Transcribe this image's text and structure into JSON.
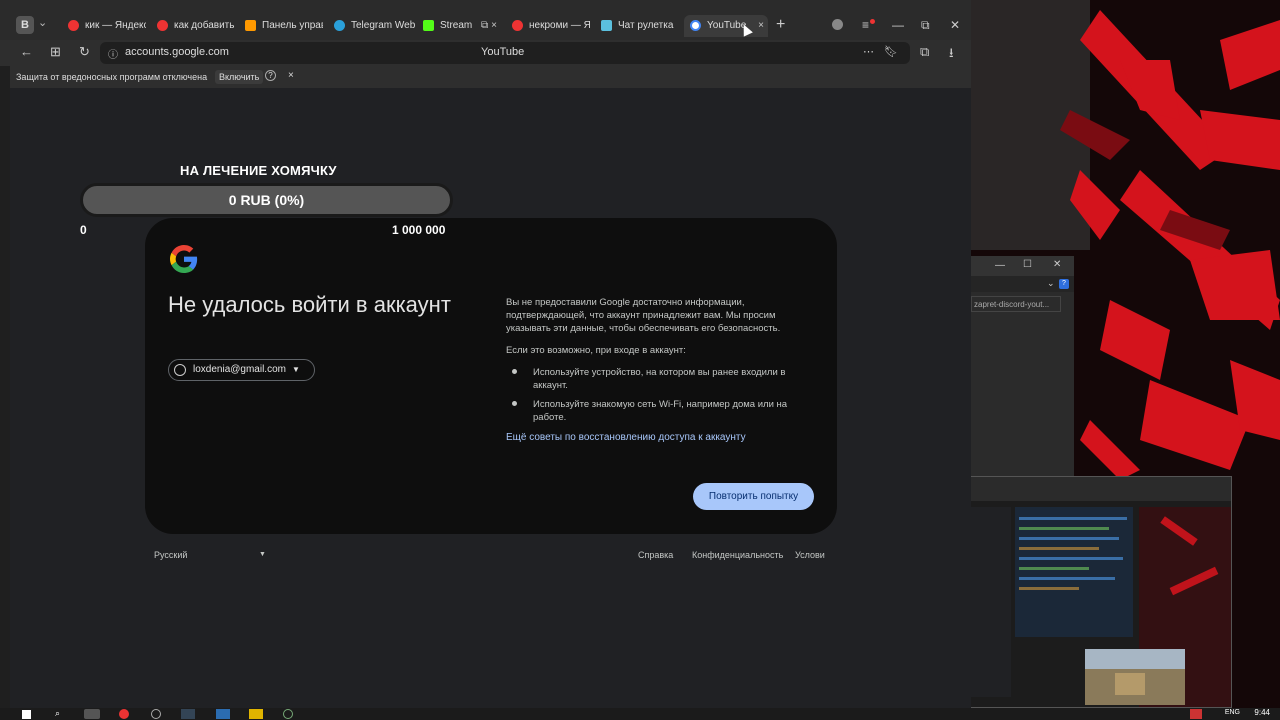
{
  "browser": {
    "tabs": [
      {
        "label": "кик — Яндекс",
        "fav": "#e33",
        "close": false
      },
      {
        "label": "как добавить",
        "fav": "#e33",
        "close": false
      },
      {
        "label": "Панель управ",
        "fav": "#f90",
        "close": false
      },
      {
        "label": "Telegram Web",
        "fav": "#2aa0da",
        "close": false
      },
      {
        "label": "Stream",
        "fav": "#53fc18",
        "close": true
      },
      {
        "label": "некроми — Ян",
        "fav": "#e33",
        "close": false
      },
      {
        "label": "Чат рулетка",
        "fav": "#5bc0de",
        "close": false
      },
      {
        "label": "YouTube",
        "fav": "#ffffff",
        "close": true
      }
    ],
    "url": "accounts.google.com",
    "page_title": "YouTube",
    "infobar_text": "Защита от вредоносных программ отключена",
    "infobar_button": "Включить"
  },
  "donation": {
    "title": "НА ЛЕЧЕНИЕ ХОМЯЧКУ",
    "progress_label": "0 RUB (0%)",
    "progress": 0,
    "min_label": "0",
    "max_label": "1 000 000"
  },
  "google": {
    "title": "Не удалось войти в аккаунт",
    "account": "loxdenia@gmail.com",
    "p1": "Вы не предоставили Google достаточно информации, подтверждающей, что аккаунт принадлежит вам. Мы просим указывать эти данные, чтобы обеспечивать его безопасность.",
    "p2": "Если это возможно, при входе в аккаунт:",
    "tip1": "Используйте устройство, на котором вы ранее входили в аккаунт.",
    "tip2": "Используйте знакомую сеть Wi-Fi, например дома или на работе.",
    "link": "Ещё советы по восстановлению доступа к аккаунту",
    "retry_button": "Повторить попытку"
  },
  "footer": {
    "language": "Русский",
    "help": "Справка",
    "privacy": "Конфиденциальность",
    "terms": "Услови"
  },
  "devtools": {
    "search_text": "zapret-discord-yout..."
  },
  "taskbar": {
    "lang": "ENG",
    "time": "9:44"
  },
  "colors": {
    "accent_button": "#a8c7fa",
    "link": "#a8c7fa",
    "wallpaper_red": "#e0141e"
  }
}
